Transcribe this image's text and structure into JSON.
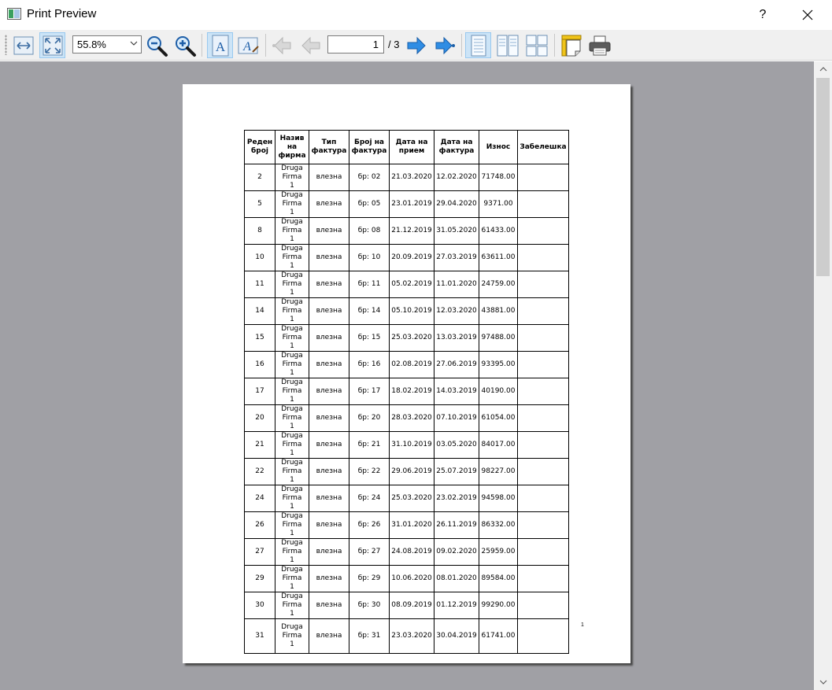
{
  "window": {
    "title": "Print Preview",
    "help_label": "?"
  },
  "toolbar": {
    "zoom_value": "55.8%",
    "current_page": "1",
    "page_total": "/ 3",
    "buttons": [
      {
        "name": "fit-width",
        "icon": "fit-width-icon"
      },
      {
        "name": "fit-page",
        "icon": "fit-page-icon",
        "active": true
      },
      {
        "name": "zoom-out",
        "icon": "zoom-out-icon"
      },
      {
        "name": "zoom-in",
        "icon": "zoom-in-icon"
      },
      {
        "name": "portrait",
        "icon": "portrait-icon",
        "active": true
      },
      {
        "name": "landscape",
        "icon": "landscape-icon"
      },
      {
        "name": "first-page",
        "icon": "first-page-icon"
      },
      {
        "name": "previous-page",
        "icon": "previous-page-icon"
      },
      {
        "name": "next-page",
        "icon": "next-page-icon"
      },
      {
        "name": "last-page",
        "icon": "last-page-icon"
      },
      {
        "name": "single-page",
        "icon": "single-page-icon",
        "active": true
      },
      {
        "name": "facing-pages",
        "icon": "facing-pages-icon"
      },
      {
        "name": "all-pages",
        "icon": "all-pages-icon"
      },
      {
        "name": "page-setup",
        "icon": "page-setup-icon"
      },
      {
        "name": "print",
        "icon": "printer-icon"
      }
    ]
  },
  "document": {
    "headers": [
      "Реден број",
      "Назив на фирма",
      "Тип фактура",
      "Број на фактура",
      "Дата на прием",
      "Дата на фактура",
      "Износ",
      "Забелешка"
    ],
    "rows": [
      [
        "2",
        "Druga Firma 1",
        "влезна",
        "бр: 02",
        "21.03.2020",
        "12.02.2020",
        "71748.00",
        ""
      ],
      [
        "5",
        "Druga Firma 1",
        "влезна",
        "бр: 05",
        "23.01.2019",
        "29.04.2020",
        "9371.00",
        ""
      ],
      [
        "8",
        "Druga Firma 1",
        "влезна",
        "бр: 08",
        "21.12.2019",
        "31.05.2020",
        "61433.00",
        ""
      ],
      [
        "10",
        "Druga Firma 1",
        "влезна",
        "бр: 10",
        "20.09.2019",
        "27.03.2019",
        "63611.00",
        ""
      ],
      [
        "11",
        "Druga Firma 1",
        "влезна",
        "бр: 11",
        "05.02.2019",
        "11.01.2020",
        "24759.00",
        ""
      ],
      [
        "14",
        "Druga Firma 1",
        "влезна",
        "бр: 14",
        "05.10.2019",
        "12.03.2020",
        "43881.00",
        ""
      ],
      [
        "15",
        "Druga Firma 1",
        "влезна",
        "бр: 15",
        "25.03.2020",
        "13.03.2019",
        "97488.00",
        ""
      ],
      [
        "16",
        "Druga Firma 1",
        "влезна",
        "бр: 16",
        "02.08.2019",
        "27.06.2019",
        "93395.00",
        ""
      ],
      [
        "17",
        "Druga Firma 1",
        "влезна",
        "бр: 17",
        "18.02.2019",
        "14.03.2019",
        "40190.00",
        ""
      ],
      [
        "20",
        "Druga Firma 1",
        "влезна",
        "бр: 20",
        "28.03.2020",
        "07.10.2019",
        "61054.00",
        ""
      ],
      [
        "21",
        "Druga Firma 1",
        "влезна",
        "бр: 21",
        "31.10.2019",
        "03.05.2020",
        "84017.00",
        ""
      ],
      [
        "22",
        "Druga Firma 1",
        "влезна",
        "бр: 22",
        "29.06.2019",
        "25.07.2019",
        "98227.00",
        ""
      ],
      [
        "24",
        "Druga Firma 1",
        "влезна",
        "бр: 24",
        "25.03.2020",
        "23.02.2019",
        "94598.00",
        ""
      ],
      [
        "26",
        "Druga Firma 1",
        "влезна",
        "бр: 26",
        "31.01.2020",
        "26.11.2019",
        "86332.00",
        ""
      ],
      [
        "27",
        "Druga Firma 1",
        "влезна",
        "бр: 27",
        "24.08.2019",
        "09.02.2020",
        "25959.00",
        ""
      ],
      [
        "29",
        "Druga Firma 1",
        "влезна",
        "бр: 29",
        "10.06.2020",
        "08.01.2020",
        "89584.00",
        ""
      ],
      [
        "30",
        "Druga Firma 1",
        "влезна",
        "бр: 30",
        "08.09.2019",
        "01.12.2019",
        "99290.00",
        ""
      ],
      [
        "31",
        "Druga Firma 1",
        "влезна",
        "бр: 31",
        "23.03.2020",
        "30.04.2019",
        "61741.00",
        ""
      ]
    ],
    "page_number": "1"
  }
}
